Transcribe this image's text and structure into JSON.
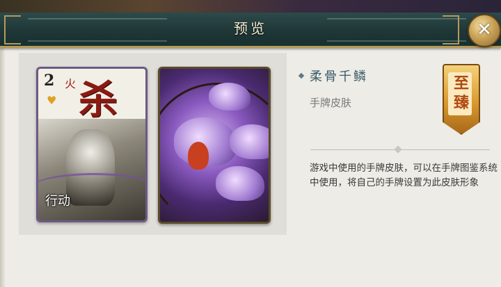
{
  "dialog": {
    "title": "预览",
    "close_label": "✕"
  },
  "card_preview": {
    "card_number": "2",
    "card_suit": "火",
    "card_char": "杀",
    "card_action_label": "行动"
  },
  "skin": {
    "name": "柔骨千鳞",
    "type": "手牌皮肤",
    "badge_text": "至臻",
    "description": "游戏中使用的手牌皮肤，可以在手牌图鉴系统中使用，将自己的手牌设置为此皮肤形象"
  },
  "colors": {
    "title_bar": "#1f3737",
    "accent_gold": "#c9a256",
    "skin_name": "#3a5a6a",
    "card_border": "#6b5a86"
  }
}
